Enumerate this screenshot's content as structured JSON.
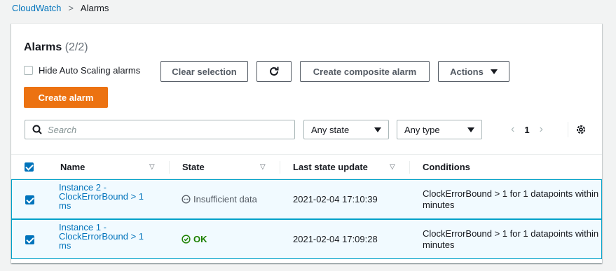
{
  "breadcrumb": {
    "root": "CloudWatch",
    "separator": ">",
    "current": "Alarms"
  },
  "header": {
    "title": "Alarms",
    "count": "(2/2)"
  },
  "controls": {
    "hide_autoscaling_label": "Hide Auto Scaling alarms",
    "hide_autoscaling_checked": false,
    "clear_selection": "Clear selection",
    "create_composite": "Create composite alarm",
    "actions": "Actions",
    "create_alarm": "Create alarm"
  },
  "filters": {
    "search_placeholder": "Search",
    "state_select": "Any state",
    "type_select": "Any type",
    "page": "1"
  },
  "table": {
    "columns": [
      "Name",
      "State",
      "Last state update",
      "Conditions"
    ],
    "rows": [
      {
        "name": "Instance 2 - ClockErrorBound > 1 ms",
        "state": "Insufficient data",
        "last_update": "2021-02-04 17:10:39",
        "conditions": "ClockErrorBound > 1 for 1 datapoints within minutes",
        "selected": true
      },
      {
        "name": "Instance 1 - ClockErrorBound > 1 ms",
        "state": "OK",
        "last_update": "2021-02-04 17:09:28",
        "conditions": "ClockErrorBound > 1 for 1 datapoints within minutes",
        "selected": true
      }
    ]
  },
  "colors": {
    "link": "#0073bb",
    "primary_button": "#ec7211",
    "ok": "#1d8102",
    "selected_row_bg": "#f1faff",
    "selected_row_border": "#00a1c9"
  }
}
